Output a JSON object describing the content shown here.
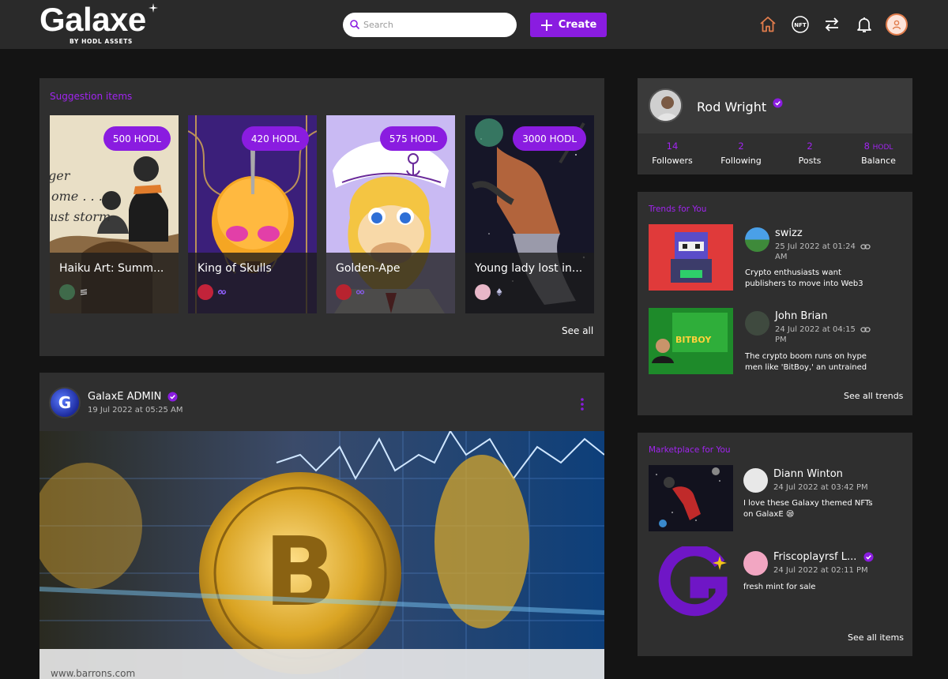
{
  "header": {
    "logo_text": "Galaxe",
    "logo_sub": "BY HODL ASSETS",
    "search_placeholder": "Search",
    "create_label": "Create",
    "nft_icon_text": "NFT"
  },
  "suggestions": {
    "title": "Suggestion items",
    "see_all": "See all",
    "items": [
      {
        "name": "Haiku Art: Summ...",
        "price": "500 HODL",
        "art_text": [
          "ger",
          "ome . . .",
          "ust storm"
        ]
      },
      {
        "name": "King of Skulls",
        "price": "420 HODL"
      },
      {
        "name": "Golden-Ape",
        "price": "575 HODL"
      },
      {
        "name": "Young lady lost in...",
        "price": "3000 HODL"
      }
    ]
  },
  "post": {
    "author": "GalaxE ADMIN",
    "date": "19 Jul 2022 at 05:25 AM",
    "avatar_letter": "G",
    "image_caption": "www.barrons.com"
  },
  "profile": {
    "name": "Rod Wright",
    "stats": [
      {
        "value": "14",
        "label": "Followers"
      },
      {
        "value": "2",
        "label": "Following"
      },
      {
        "value": "2",
        "label": "Posts"
      },
      {
        "value": "8",
        "unit": "HODL",
        "label": "Balance"
      }
    ]
  },
  "trends": {
    "title": "Trends for You",
    "see_all": "See all trends",
    "items": [
      {
        "user": "swizz",
        "date_line1": "25 Jul 2022 at 01:24",
        "date_line2": "AM",
        "text_line1": "Crypto enthusiasts want",
        "text_line2": "publishers to move into Web3"
      },
      {
        "user": "John Brian",
        "date_line1": "24 Jul 2022 at 04:15",
        "date_line2": "PM",
        "text_line1": "The crypto boom runs on hype",
        "text_line2": "men like 'BitBoy,' an untrained",
        "thumb_text": "BITBOY"
      }
    ]
  },
  "marketplace": {
    "title": "Marketplace for You",
    "see_all": "See all items",
    "items": [
      {
        "user": "Diann Winton",
        "date": "24 Jul 2022 at 03:42 PM",
        "text_line1": "I love these Galaxy themed NFTs",
        "text_line2": "on GalaxE 😪"
      },
      {
        "user": "Friscoplayrsf L...",
        "date": "24 Jul 2022 at 02:11 PM",
        "text_line1": "fresh mint for sale"
      }
    ]
  },
  "colors": {
    "accent": "#8a1ce0",
    "accent_text": "#a124f0",
    "panel": "#2f2f2f",
    "header": "#2a2a2a",
    "background": "#141414",
    "home_icon": "#e07c4c"
  }
}
